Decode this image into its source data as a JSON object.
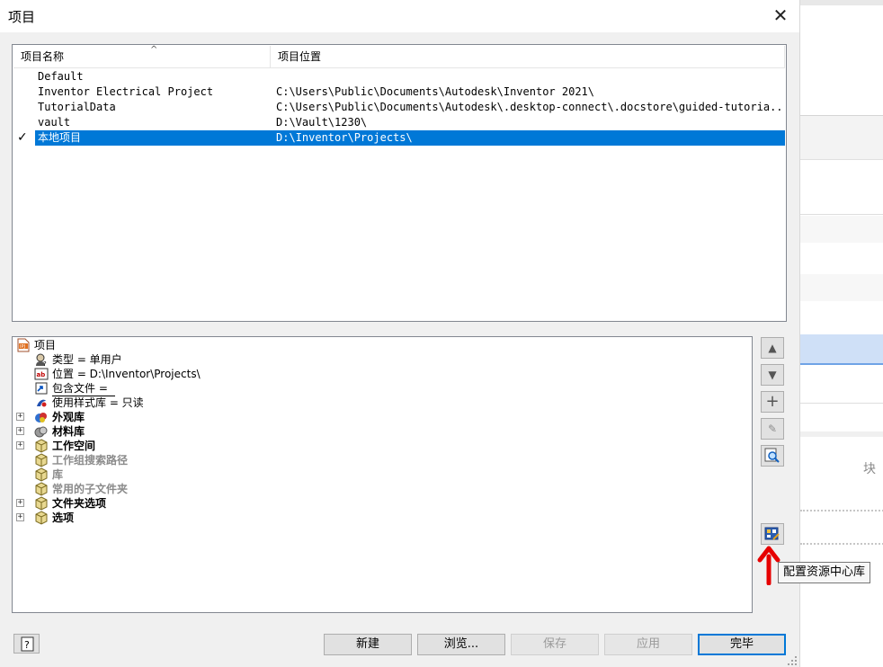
{
  "window": {
    "title": "项目",
    "close_label": "✕"
  },
  "project_list": {
    "columns": [
      "项目名称",
      "项目位置"
    ],
    "sort_indicator": "^",
    "rows": [
      {
        "name": "Default",
        "path": "",
        "active": false
      },
      {
        "name": "Inventor Electrical Project",
        "path": "C:\\Users\\Public\\Documents\\Autodesk\\Inventor 2021\\",
        "active": false
      },
      {
        "name": "TutorialData",
        "path": "C:\\Users\\Public\\Documents\\Autodesk\\.desktop-connect\\.docstore\\guided-tutoria...",
        "active": false
      },
      {
        "name": "vault",
        "path": "D:\\Vault\\1230\\",
        "active": false
      },
      {
        "name": "本地项目",
        "path": "D:\\Inventor\\Projects\\",
        "active": true,
        "check": "✓"
      }
    ]
  },
  "tree": {
    "root": "项目",
    "type_item": "类型 = 单用户",
    "location_item": "位置 = D:\\Inventor\\Projects\\",
    "included_file_item": "包含文件 =",
    "style_library_item": "使用样式库 = 只读",
    "appearance_library": "外观库",
    "material_library": "材料库",
    "workspace": "工作空间",
    "workgroup_search_paths": "工作组搜索路径",
    "libraries": "库",
    "frequent_subfolders": "常用的子文件夹",
    "folder_options": "文件夹选项",
    "options": "选项",
    "expander_symbol": "+"
  },
  "side_buttons": {
    "move_up": "▲",
    "move_down": "▼",
    "add": "+",
    "edit": "✎",
    "find": "search-icon",
    "configure_content_center": "content-center-icon"
  },
  "tooltip": {
    "text": "配置资源中心库"
  },
  "buttons": {
    "help": "?",
    "new": "新建",
    "browse": "浏览...",
    "save": "保存",
    "apply": "应用",
    "done": "完毕"
  },
  "background_window": {
    "label": "块"
  },
  "colors": {
    "selection": "#0078d7",
    "annotation_arrow": "#e60000"
  }
}
